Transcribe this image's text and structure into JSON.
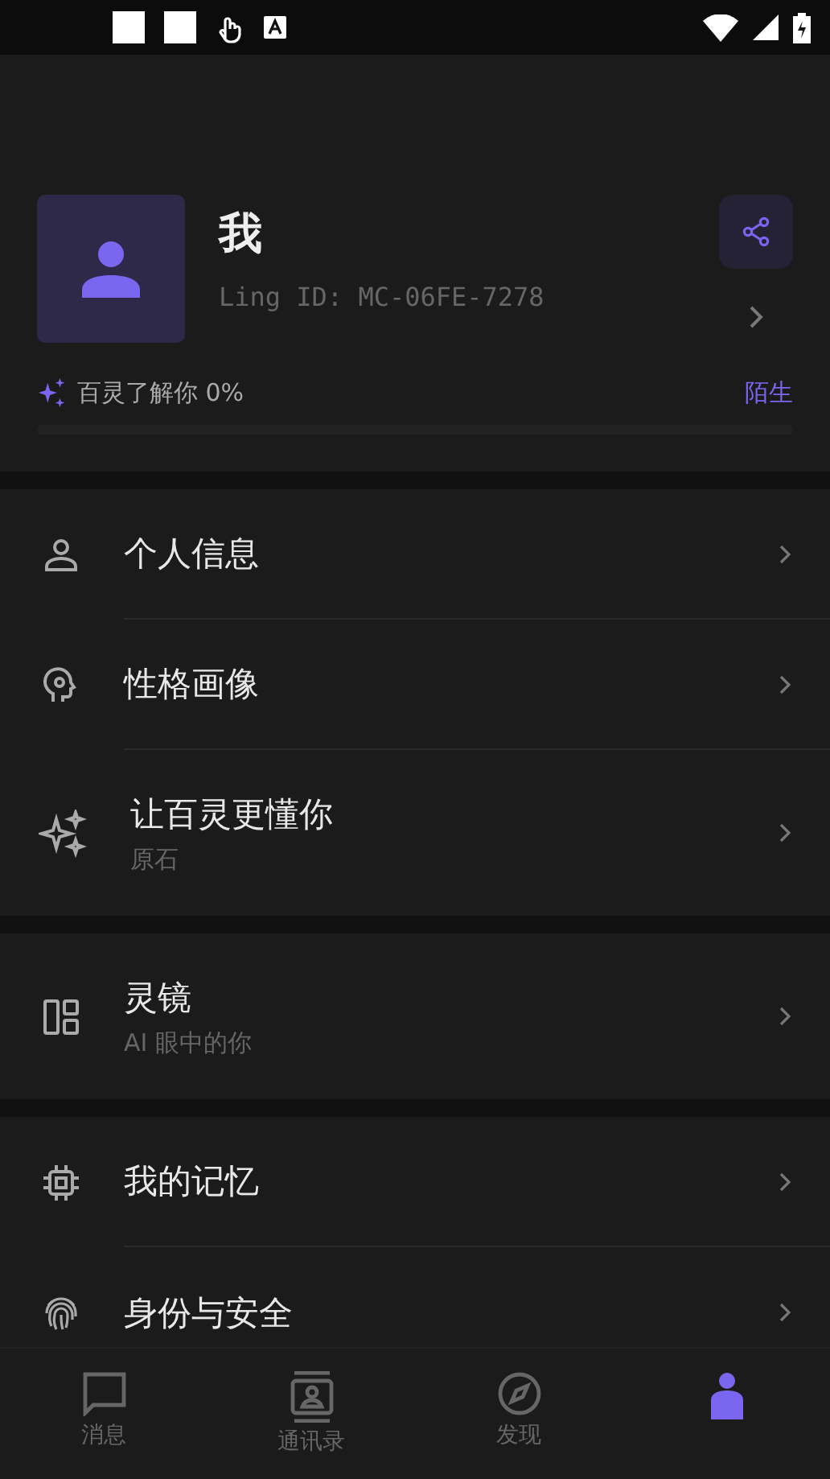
{
  "profile": {
    "name": "我",
    "ling_id": "Ling ID: MC-06FE-7278"
  },
  "understanding": {
    "label": "百灵了解你 0%",
    "status": "陌生",
    "level": 0
  },
  "sections": [
    {
      "items": [
        {
          "title": "个人信息"
        },
        {
          "title": "性格画像"
        },
        {
          "title": "让百灵更懂你",
          "subtitle": "原石"
        }
      ]
    },
    {
      "items": [
        {
          "title": "灵镜",
          "subtitle": "AI 眼中的你"
        }
      ]
    },
    {
      "items": [
        {
          "title": "我的记忆"
        },
        {
          "title": "身份与安全"
        }
      ]
    }
  ],
  "bottom_nav": [
    {
      "label": "消息",
      "selected": false
    },
    {
      "label": "通讯录",
      "selected": false
    },
    {
      "label": "发现",
      "selected": false
    },
    {
      "selected": true
    }
  ]
}
